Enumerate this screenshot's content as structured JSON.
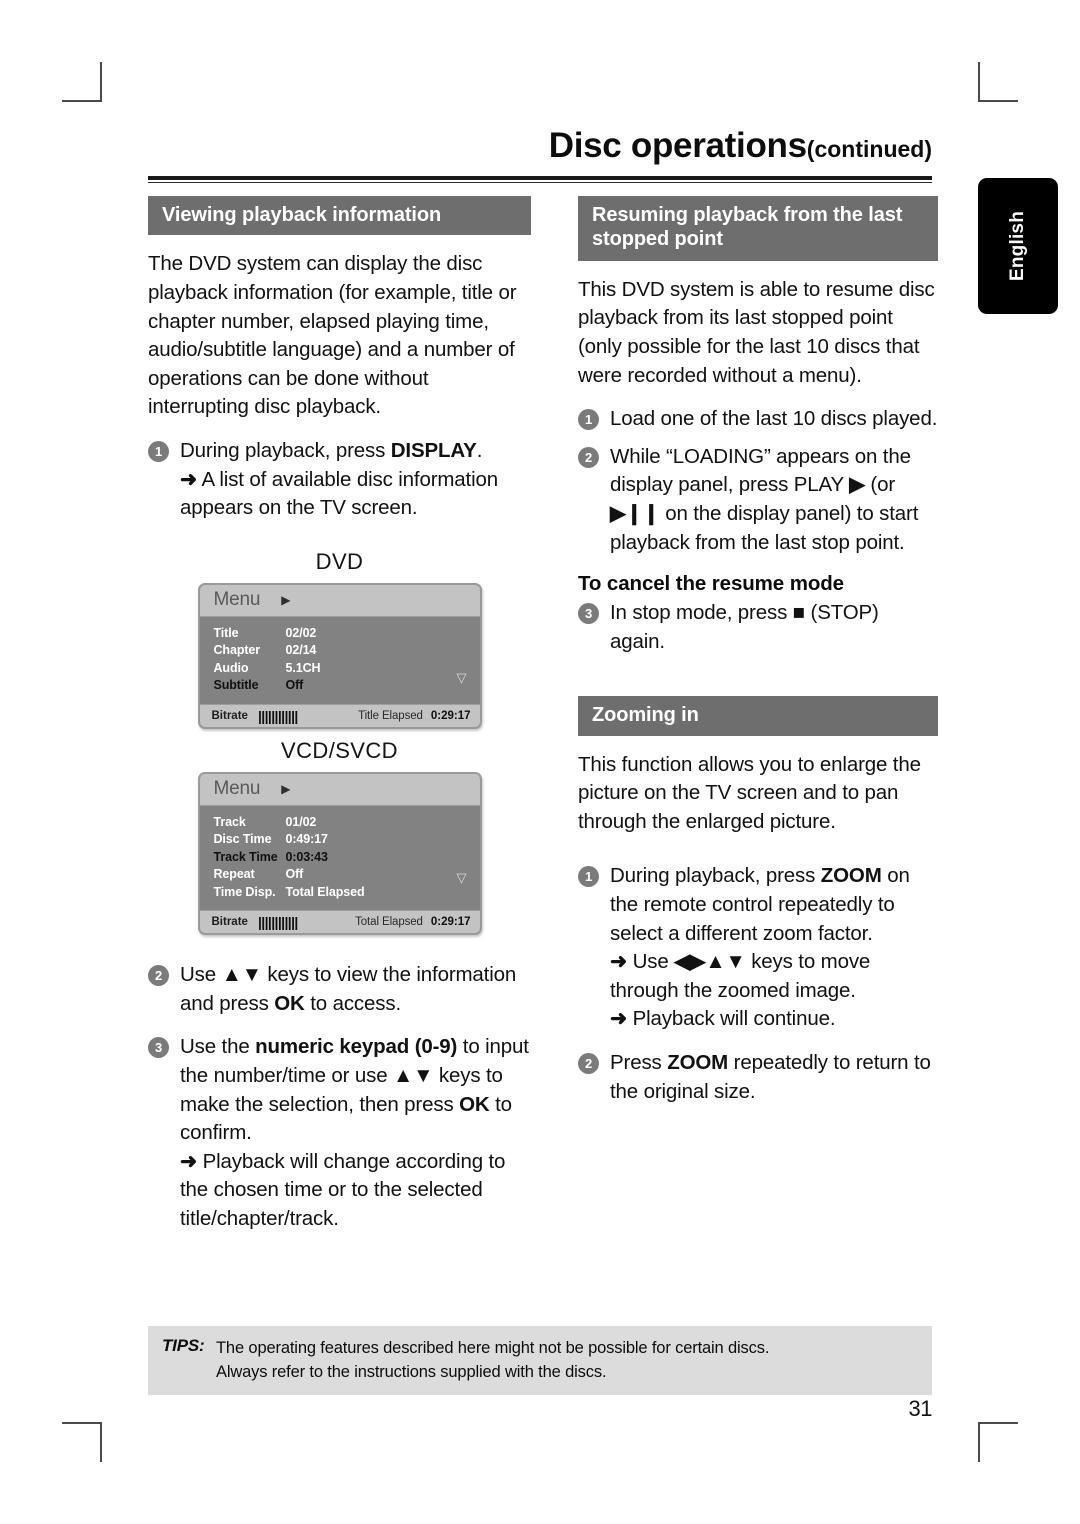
{
  "header": {
    "title": "Disc operations",
    "continued": "(continued)"
  },
  "language_tab": {
    "label": "English"
  },
  "left_column": {
    "section_heading": "Viewing playback information",
    "intro": "The DVD system can display the disc playback information (for example, title or chapter number, elapsed playing time, audio/subtitle language) and a number of operations can be done without interrupting disc playback.",
    "step1": {
      "number": "1",
      "text_before": "During playback, press ",
      "bold": "DISPLAY",
      "text_after": ".",
      "result_arrow": "➜",
      "result": "A list of available disc information appears on the TV screen."
    },
    "dvd_screen": {
      "label": "DVD",
      "menu_label": "Menu",
      "menu_arrow": "▶",
      "rows": [
        {
          "key": "Title",
          "value": "02/02",
          "highlight": false
        },
        {
          "key": "Chapter",
          "value": "02/14",
          "highlight": false
        },
        {
          "key": "Audio",
          "value": "5.1CH",
          "highlight": false
        },
        {
          "key": "Subtitle",
          "value": "Off",
          "highlight": true
        }
      ],
      "scroll_caret": "▽",
      "bitrate_label": "Bitrate",
      "bitrate_bars": "||||||||||||",
      "elapsed_label": "Title Elapsed",
      "elapsed_value": "0:29:17"
    },
    "vcd_screen": {
      "label": "VCD/SVCD",
      "menu_label": "Menu",
      "menu_arrow": "▶",
      "rows": [
        {
          "key": "Track",
          "value": "01/02",
          "highlight": false
        },
        {
          "key": "Disc Time",
          "value": "0:49:17",
          "highlight": false
        },
        {
          "key": "Track Time",
          "value": "0:03:43",
          "highlight": true
        },
        {
          "key": "Repeat",
          "value": "Off",
          "highlight": false
        },
        {
          "key": "Time Disp.",
          "value": "Total Elapsed",
          "highlight": false
        }
      ],
      "scroll_caret": "▽",
      "bitrate_label": "Bitrate",
      "bitrate_bars": "||||||||||||",
      "elapsed_label": "Total Elapsed",
      "elapsed_value": "0:29:17"
    },
    "step2": {
      "number": "2",
      "t1": "Use ",
      "keys": "▲▼",
      "t2": " keys to view the information and press ",
      "bold": "OK",
      "t3": " to access."
    },
    "step3": {
      "number": "3",
      "t1": "Use the ",
      "bold1": "numeric keypad (0-9)",
      "t2": " to input the number/time or use ",
      "keys": "▲▼",
      "t3": " keys to make the selection, then press ",
      "bold2": "OK",
      "t4": " to confirm.",
      "result_arrow": "➜",
      "result": "Playback will change according to the chosen time or to the selected title/chapter/track."
    }
  },
  "right_column": {
    "section_heading_resume": "Resuming playback from the last stopped point",
    "resume_intro": "This DVD system is able to resume disc playback from its last stopped point (only possible for the last 10 discs that were recorded without a menu).",
    "step1": {
      "number": "1",
      "text": "Load one of the last 10 discs played."
    },
    "step2": {
      "number": "2",
      "t1": "While “LOADING” appears on the display panel, press PLAY ",
      "icon_play": "▶",
      "t2": " (or ",
      "icon_playpause": "▶❙❙",
      "t3": " on the display panel) to start playback from the last stop point."
    },
    "cancel_heading": "To cancel the resume mode",
    "step3": {
      "number": "3",
      "t1": "In stop mode, press ",
      "icon_stop": "■",
      "t2": " (STOP) again."
    },
    "section_heading_zoom": "Zooming in",
    "zoom_intro": "This function allows you to enlarge the picture on the TV screen and to pan through the enlarged picture.",
    "zstep1": {
      "number": "1",
      "t1": "During playback, press ",
      "bold": "ZOOM",
      "t2": " on the remote control repeatedly to select a different zoom factor.",
      "result1_arrow": "➜",
      "result1_a": "Use ",
      "result1_keys": "◀▶▲▼",
      "result1_b": " keys to move through the zoomed image.",
      "result2_arrow": "➜",
      "result2": "Playback will continue."
    },
    "zstep2": {
      "number": "2",
      "t1": "Press ",
      "bold": "ZOOM",
      "t2": " repeatedly to return to the original size."
    }
  },
  "footer": {
    "tips_label": "TIPS:",
    "tips_line1": "The operating features described here might not be possible for certain discs.",
    "tips_line2": "Always refer to the instructions supplied with the discs.",
    "page_number": "31"
  }
}
